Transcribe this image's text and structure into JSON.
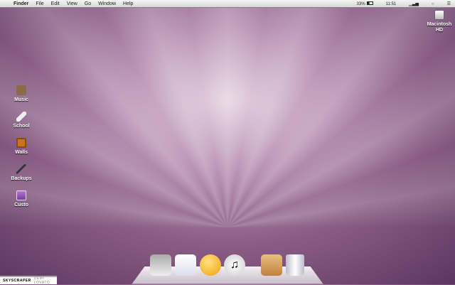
{
  "menubar": {
    "apple": "",
    "app": "Finder",
    "items": [
      "File",
      "Edit",
      "View",
      "Go",
      "Window",
      "Help"
    ],
    "battery": "33%",
    "time": "11:51"
  },
  "desktop": {
    "drive": "Macintosh HD",
    "icons": [
      "Music",
      "School",
      "Walls",
      "Backups",
      "Custo"
    ]
  },
  "caption": {
    "title": "SKYSCRAPER",
    "artist": "DEMI LOVATO"
  }
}
